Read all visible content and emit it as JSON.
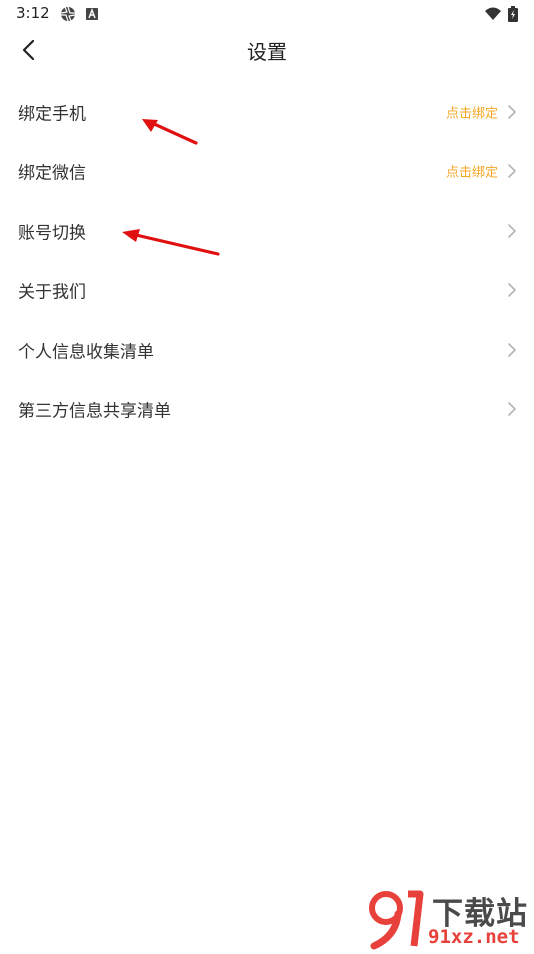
{
  "status_bar": {
    "time": "3:12",
    "left_icons": [
      "aperture-icon",
      "a-box-icon"
    ],
    "right_icons": [
      "wifi-icon",
      "battery-charging-icon"
    ]
  },
  "header": {
    "title": "设置",
    "back_icon": "chevron-left-icon"
  },
  "menu_items": [
    {
      "label": "绑定手机",
      "action": "点击绑定"
    },
    {
      "label": "绑定微信",
      "action": "点击绑定"
    },
    {
      "label": "账号切换",
      "action": ""
    },
    {
      "label": "关于我们",
      "action": ""
    },
    {
      "label": "个人信息收集清单",
      "action": ""
    },
    {
      "label": "第三方信息共享清单",
      "action": ""
    }
  ],
  "colors": {
    "action_text": "#f5a623",
    "annotation_arrow": "#e01010",
    "watermark_brand": "#e8413c"
  },
  "watermark": {
    "brand_text": "下载站",
    "domain_text": "91xz.net"
  }
}
